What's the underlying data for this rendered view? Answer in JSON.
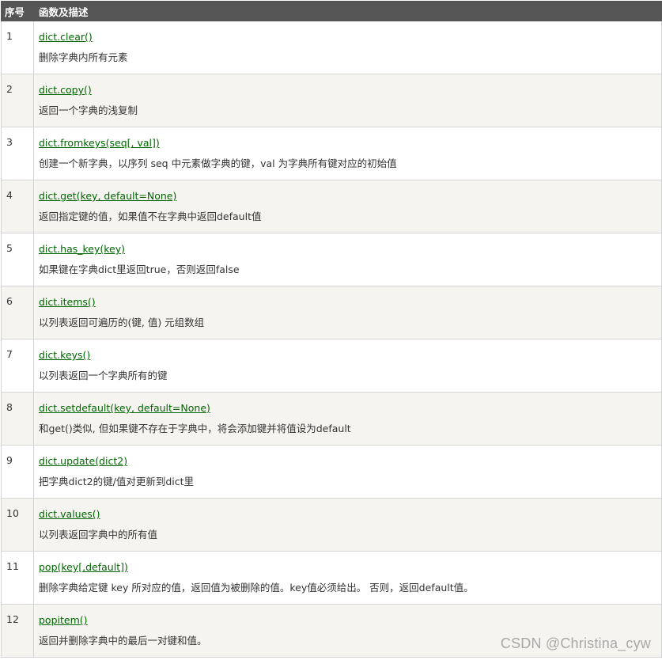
{
  "header": {
    "num_label": "序号",
    "desc_label": "函数及描述"
  },
  "rows": [
    {
      "num": "1",
      "func": "dict.clear()",
      "desc": "删除字典内所有元素"
    },
    {
      "num": "2",
      "func": "dict.copy()",
      "desc": "返回一个字典的浅复制"
    },
    {
      "num": "3",
      "func": "dict.fromkeys(seq[, val])",
      "desc": "创建一个新字典，以序列 seq 中元素做字典的键，val 为字典所有键对应的初始值"
    },
    {
      "num": "4",
      "func": "dict.get(key, default=None)",
      "desc": "返回指定键的值，如果值不在字典中返回default值"
    },
    {
      "num": "5",
      "func": "dict.has_key(key)",
      "desc": "如果键在字典dict里返回true，否则返回false"
    },
    {
      "num": "6",
      "func": "dict.items()",
      "desc": "以列表返回可遍历的(键, 值) 元组数组"
    },
    {
      "num": "7",
      "func": "dict.keys()",
      "desc": "以列表返回一个字典所有的键"
    },
    {
      "num": "8",
      "func": "dict.setdefault(key, default=None)",
      "desc": "和get()类似, 但如果键不存在于字典中，将会添加键并将值设为default"
    },
    {
      "num": "9",
      "func": "dict.update(dict2)",
      "desc": "把字典dict2的键/值对更新到dict里"
    },
    {
      "num": "10",
      "func": "dict.values()",
      "desc": "以列表返回字典中的所有值"
    },
    {
      "num": "11",
      "func": "pop(key[,default])",
      "desc": "删除字典给定键 key 所对应的值，返回值为被删除的值。key值必须给出。 否则，返回default值。"
    },
    {
      "num": "12",
      "func": "popitem()",
      "desc": "返回并删除字典中的最后一对键和值。"
    }
  ],
  "watermark": "CSDN @Christina_cyw",
  "colors": {
    "header_bg": "#555555",
    "link": "#006600",
    "row_alt": "#f6f4f0",
    "border": "#d4d4d4"
  }
}
